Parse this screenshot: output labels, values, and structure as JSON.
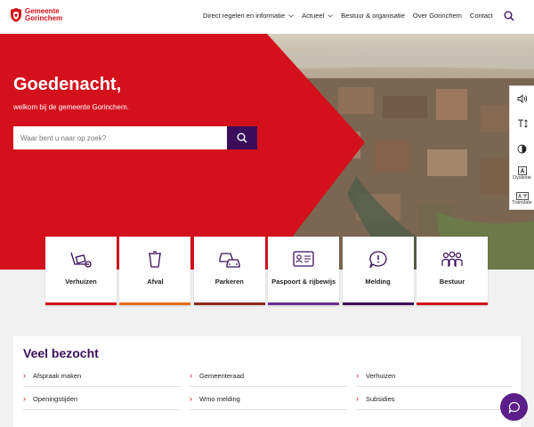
{
  "header": {
    "logo_line1": "Gemeente",
    "logo_line2": "Gorinchem",
    "nav": [
      {
        "label": "Direct regelen en informatie",
        "has_dropdown": true
      },
      {
        "label": "Actueel",
        "has_dropdown": true
      },
      {
        "label": "Bestuur & organisatie",
        "has_dropdown": false
      },
      {
        "label": "Over Gorinchem",
        "has_dropdown": false
      },
      {
        "label": "Contact",
        "has_dropdown": false
      }
    ]
  },
  "hero": {
    "greeting": "Goedenacht,",
    "subgreeting": "welkom bij de gemeente Gorinchem.",
    "search_placeholder": "Waar bent u naar op zoek?"
  },
  "a11y": {
    "dyslexie_label": "Dyslexie",
    "translate_label": "Translate"
  },
  "tiles": [
    {
      "label": "Verhuizen",
      "icon": "moving-truck-icon",
      "color": "#d4101c"
    },
    {
      "label": "Afval",
      "icon": "trash-icon",
      "color": "#e16c1b"
    },
    {
      "label": "Parkeren",
      "icon": "cars-icon",
      "color": "#8b2a1f"
    },
    {
      "label": "Paspoort & rijbewijs",
      "icon": "id-card-icon",
      "color": "#6a2c91"
    },
    {
      "label": "Melding",
      "icon": "alert-bubble-icon",
      "color": "#3a0e5b"
    },
    {
      "label": "Bestuur",
      "icon": "people-icon",
      "color": "#d4101c"
    }
  ],
  "popular": {
    "title": "Veel bezocht",
    "links": [
      "Afspraak maken",
      "Gemeenteraad",
      "Verhuizen",
      "Openingstijden",
      "Wmo melding",
      "Subsidies"
    ]
  },
  "colors": {
    "brand_red": "#d4101c",
    "brand_purple": "#3a0e5b",
    "chat_purple": "#5c1f8a"
  }
}
